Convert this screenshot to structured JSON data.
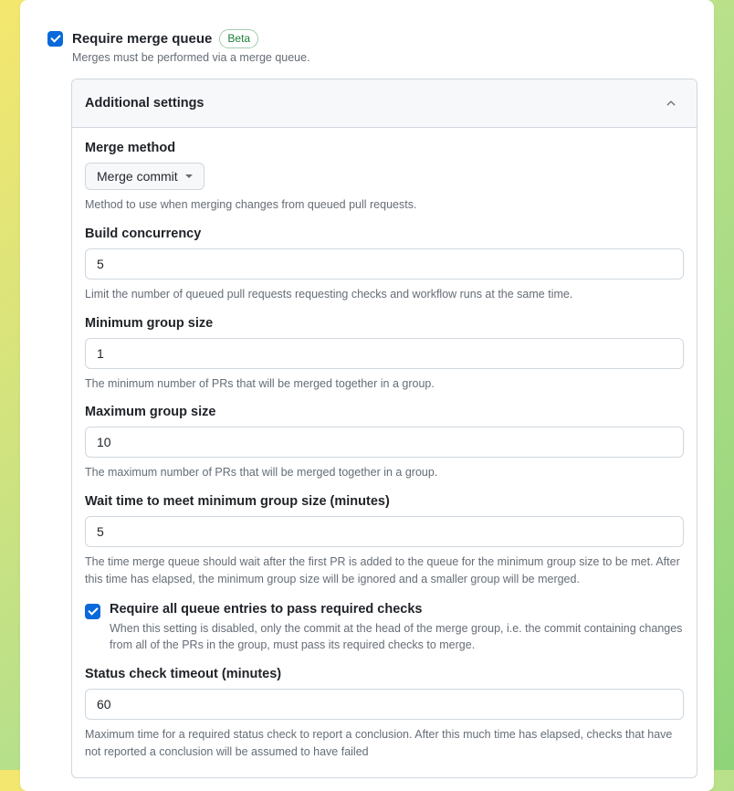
{
  "main": {
    "title": "Require merge queue",
    "badge": "Beta",
    "description": "Merges must be performed via a merge queue."
  },
  "panel": {
    "title": "Additional settings"
  },
  "fields": {
    "merge_method": {
      "label": "Merge method",
      "value": "Merge commit",
      "help": "Method to use when merging changes from queued pull requests."
    },
    "build_concurrency": {
      "label": "Build concurrency",
      "value": "5",
      "help": "Limit the number of queued pull requests requesting checks and workflow runs at the same time."
    },
    "min_group": {
      "label": "Minimum group size",
      "value": "1",
      "help": "The minimum number of PRs that will be merged together in a group."
    },
    "max_group": {
      "label": "Maximum group size",
      "value": "10",
      "help": "The maximum number of PRs that will be merged together in a group."
    },
    "wait_time": {
      "label": "Wait time to meet minimum group size (minutes)",
      "value": "5",
      "help": "The time merge queue should wait after the first PR is added to the queue for the minimum group size to be met. After this time has elapsed, the minimum group size will be ignored and a smaller group will be merged."
    },
    "require_checks": {
      "label": "Require all queue entries to pass required checks",
      "help": "When this setting is disabled, only the commit at the head of the merge group, i.e. the commit containing changes from all of the PRs in the group, must pass its required checks to merge."
    },
    "status_timeout": {
      "label": "Status check timeout (minutes)",
      "value": "60",
      "help": "Maximum time for a required status check to report a conclusion. After this much time has elapsed, checks that have not reported a conclusion will be assumed to have failed"
    }
  }
}
